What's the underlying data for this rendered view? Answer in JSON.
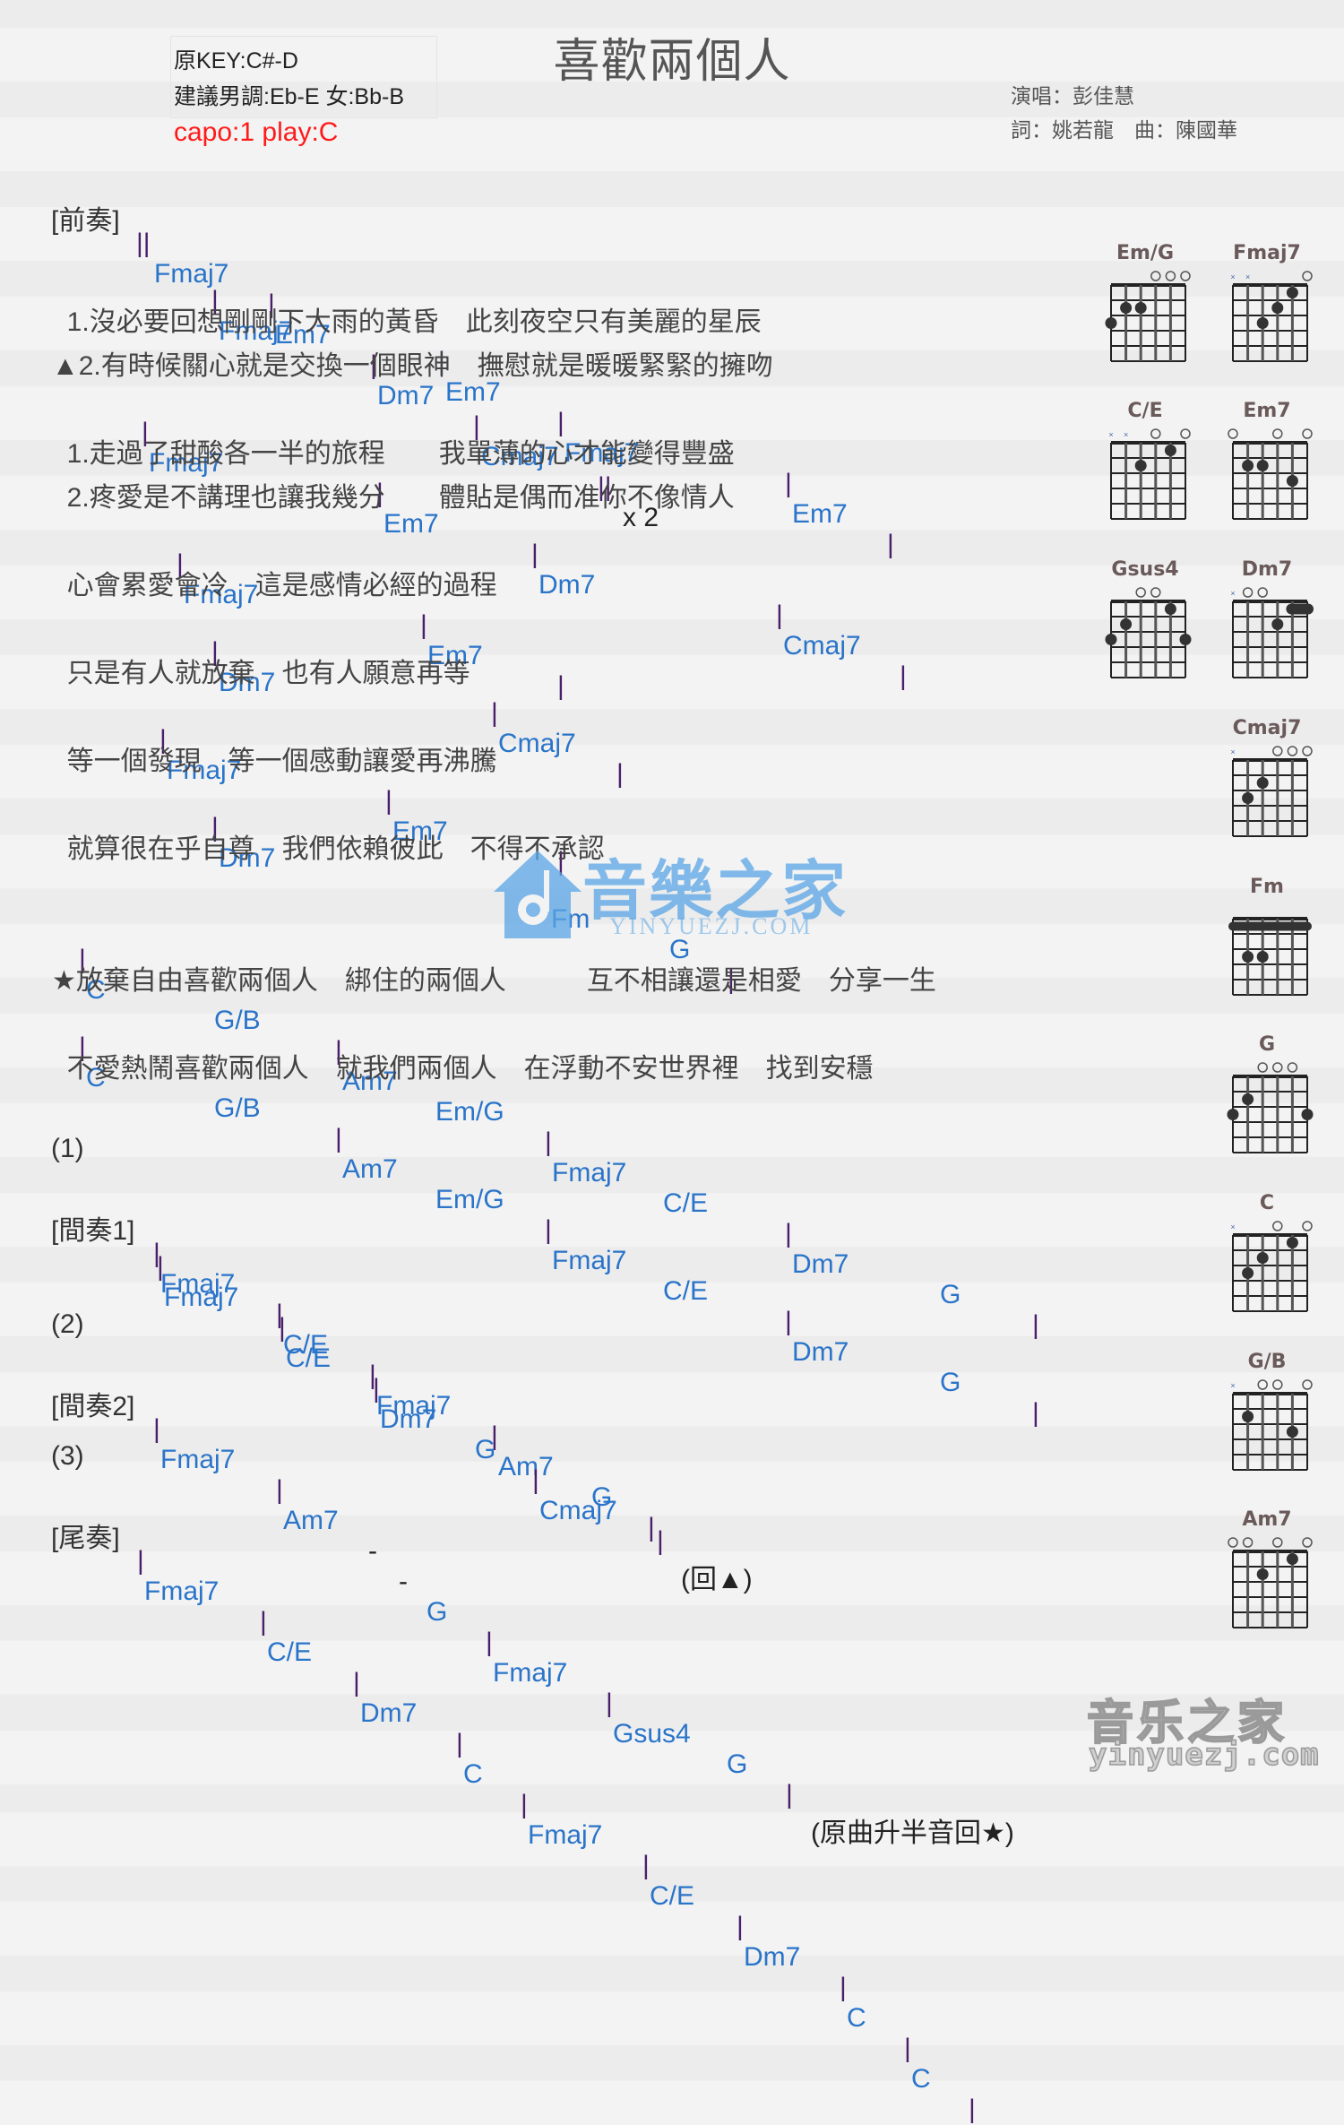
{
  "header": {
    "title": "喜歡兩個人",
    "original_key": "原KEY:C#-D",
    "suggested_key": "建議男調:Eb-E 女:Bb-B",
    "capo": "capo:1 play:C",
    "singer": "演唱：彭佳慧",
    "credits": "詞：姚若龍　曲：陳國華"
  },
  "intro": {
    "label": "[前奏]",
    "open_bar": "||",
    "chords": [
      "Fmaj7",
      "Em7",
      "Dm7",
      "Cmaj7"
    ],
    "close": "||",
    "repeat": "x 2"
  },
  "verse": [
    {
      "chords": [
        "Fmaj7",
        "Em7",
        "Fmaj7",
        "Em7"
      ]
    },
    {
      "lyric": "  1.沒必要回想剛剛下大雨的黃昏　此刻夜空只有美麗的星辰"
    },
    {
      "lyric": "▲2.有時候關心就是交換一個眼神　撫慰就是暖暖緊緊的擁吻"
    },
    {
      "chords": [
        "Fmaj7",
        "Em7",
        "Dm7",
        "Cmaj7"
      ]
    },
    {
      "lyric": "  1.走過了甜酸各一半的旅程　　我單薄的心才能變得豐盛"
    },
    {
      "lyric": "  2.疼愛是不講理也讓我幾分　　體貼是偶而准你不像情人"
    },
    {
      "chords": [
        "Fmaj7",
        "Em7"
      ]
    },
    {
      "lyric": "  心會累愛會冷　這是感情必經的過程"
    },
    {
      "chords": [
        "Dm7",
        "Cmaj7"
      ]
    },
    {
      "lyric": "  只是有人就放棄　也有人願意再等"
    },
    {
      "chords": [
        "Fmaj7",
        "Em7"
      ]
    },
    {
      "lyric": "  等一個發現　等一個感動讓愛再沸騰"
    },
    {
      "chords": [
        "Dm7",
        "Fm",
        "G"
      ]
    },
    {
      "lyric": "  就算很在乎自尊　我們依賴彼此　不得不承認"
    }
  ],
  "chorus": [
    {
      "chords": [
        "C",
        "G/B",
        "Am7",
        "Em/G",
        "Fmaj7",
        "C/E",
        "Dm7",
        "G"
      ]
    },
    {
      "lyric": "★放棄自由喜歡兩個人　綁住的兩個人　　　互不相讓還是相愛　分享一生"
    },
    {
      "chords": [
        "C",
        "G/B",
        "Am7",
        "Em/G",
        "Fmaj7",
        "C/E",
        "Dm7",
        "G"
      ]
    },
    {
      "lyric": "  不愛熱鬧喜歡兩個人　就我們兩個人　在浮動不安世界裡　找到安穩"
    }
  ],
  "interlude1": {
    "marker": "(1)",
    "label": "[間奏1]",
    "row1": [
      "Fmaj7",
      "C/E",
      "Fmaj7",
      "Am7",
      "G"
    ],
    "row2": [
      "Fmaj7",
      "C/E",
      "Dm7",
      "G",
      "Cmaj7"
    ],
    "note": "(回▲)"
  },
  "interlude2": {
    "marker": "(2)",
    "label": "[間奏2]",
    "chords": [
      "Fmaj7",
      "Am7",
      "-",
      "-",
      "G",
      "Fmaj7",
      "Gsus4",
      "G"
    ],
    "note": "(原曲升半音回★)"
  },
  "outro": {
    "marker": "(3)",
    "label": "[尾奏]",
    "chords": [
      "Fmaj7",
      "C/E",
      "Dm7",
      "C",
      "Fmaj7",
      "C/E",
      "Dm7",
      "C",
      "C"
    ]
  },
  "bar_symbol": "|",
  "chord_diagrams": [
    {
      "name": "Em/G",
      "strings": [
        "3",
        "2",
        "2",
        "0",
        "0",
        "0"
      ]
    },
    {
      "name": "Fmaj7",
      "strings": [
        "x",
        "x",
        "3",
        "2",
        "1",
        "0"
      ]
    },
    {
      "name": "C/E",
      "strings": [
        "x",
        "x",
        "2",
        "0",
        "1",
        "0"
      ]
    },
    {
      "name": "Em7",
      "strings": [
        "0",
        "2",
        "2",
        "0",
        "3",
        "0"
      ]
    },
    {
      "name": "Gsus4",
      "strings": [
        "3",
        "2",
        "0",
        "0",
        "1",
        "3"
      ]
    },
    {
      "name": "Dm7",
      "strings": [
        "x",
        "0",
        "0",
        "2",
        "1",
        "1"
      ]
    },
    {
      "name": "Cmaj7",
      "strings": [
        "x",
        "3",
        "2",
        "0",
        "0",
        "0"
      ]
    },
    {
      "name": "Fm",
      "strings": [
        "1",
        "3",
        "3",
        "1",
        "1",
        "1"
      ]
    },
    {
      "name": "G",
      "strings": [
        "3",
        "2",
        "0",
        "0",
        "0",
        "3"
      ]
    },
    {
      "name": "C",
      "strings": [
        "x",
        "3",
        "2",
        "0",
        "1",
        "0"
      ]
    },
    {
      "name": "G/B",
      "strings": [
        "x",
        "2",
        "0",
        "0",
        "3",
        "0"
      ]
    },
    {
      "name": "Am7",
      "strings": [
        "0",
        "0",
        "2",
        "0",
        "1",
        "0"
      ]
    }
  ],
  "watermarks": {
    "center_big": "音樂之家",
    "center_small": "YINYUEZJ.COM",
    "corner_big": "音乐之家",
    "corner_small": "yinyuezj.com"
  }
}
